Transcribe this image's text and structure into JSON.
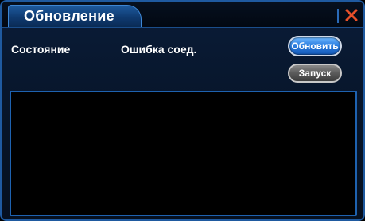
{
  "window": {
    "title": "Обновление",
    "close_icon": "close-x-icon",
    "accent_color": "#1e5a9e",
    "close_color": "#e8502a"
  },
  "status": {
    "label": "Состояние",
    "value": "Ошибка соед."
  },
  "buttons": {
    "update_label": "Обновить",
    "launch_label": "Запуск"
  },
  "log": {
    "content": ""
  }
}
